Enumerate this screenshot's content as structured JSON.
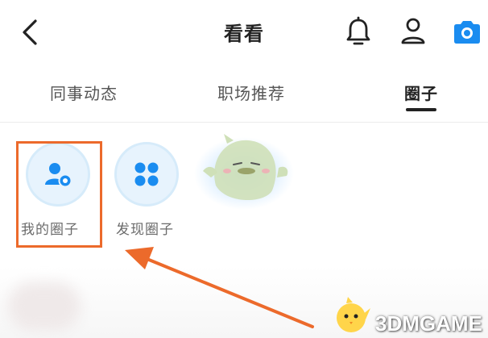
{
  "header": {
    "title": "看看",
    "icons": [
      "back-arrow-icon",
      "bell-icon",
      "user-icon",
      "camera-icon"
    ],
    "accent_color": "#1a8cf0"
  },
  "tabs": [
    {
      "label": "同事动态",
      "active": false
    },
    {
      "label": "职场推荐",
      "active": false
    },
    {
      "label": "圈子",
      "active": true
    }
  ],
  "circles": [
    {
      "label": "我的圈子",
      "icon": "my-circle-icon",
      "highlighted": true
    },
    {
      "label": "发现圈子",
      "icon": "discover-circle-icon",
      "highlighted": false
    }
  ],
  "annotation": {
    "highlight_color": "#ec6a2b",
    "arrow_color": "#ec6a2b"
  },
  "watermark": {
    "text": "3DMGAME",
    "icon": "chick-mascot-icon"
  }
}
